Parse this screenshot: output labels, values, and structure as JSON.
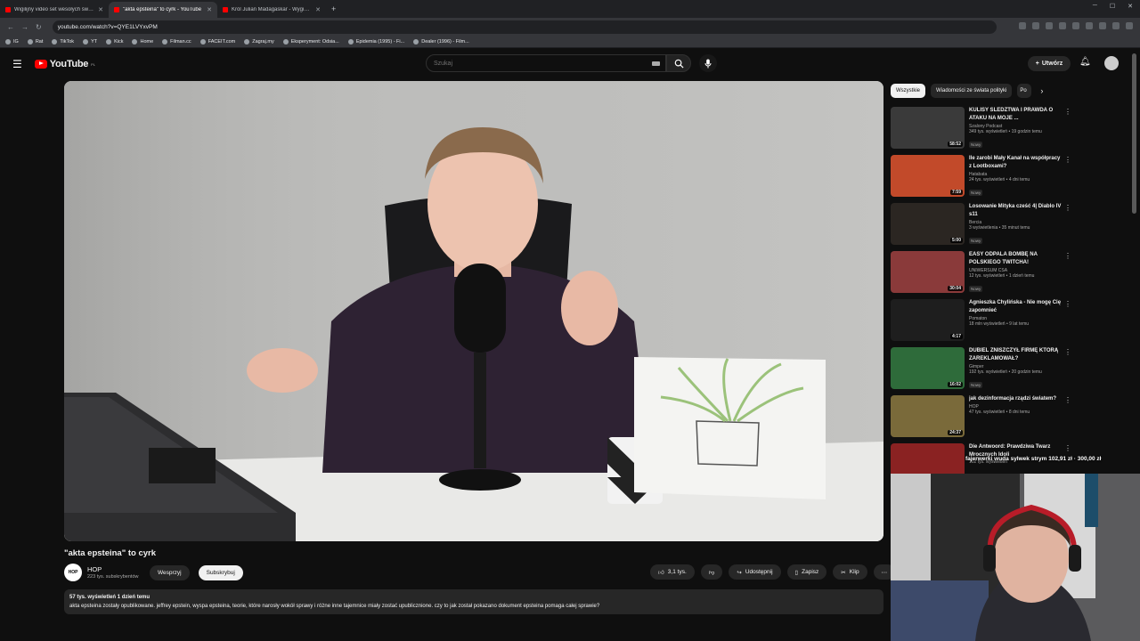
{
  "browser": {
    "tabs": [
      {
        "label": "Wigilijny video set wesołych świąt i..."
      },
      {
        "label": "\"akta epsteina\" to cyrk - YouTube"
      },
      {
        "label": "Król Julian Madagaskar - Wyginam S..."
      }
    ],
    "url": "youtube.com/watch?v=QYE1LVYxvPM",
    "bookmarks": [
      "IG",
      "Rat",
      "TikTok",
      "YT",
      "Kick",
      "Home",
      "Filman.cc",
      "FACEIT.com",
      "Zagraj.my",
      "Eksperyment: Odsia...",
      "Epidemia (1995) - Fi...",
      "Dealer (1996) - Film..."
    ]
  },
  "youtube": {
    "logo": "YouTube",
    "country": "PL",
    "search_placeholder": "Szukaj",
    "create_label": "Utwórz"
  },
  "video": {
    "title": "\"akta epsteina\" to cyrk",
    "channel": "HOP",
    "channel_avatar": "HOP",
    "subscribers": "223 tys. subskrybentów",
    "support_label": "Wesprzyj",
    "subscribe_label": "Subskrybuj",
    "likes": "3,1 tys.",
    "share_label": "Udostępnij",
    "save_label": "Zapisz",
    "clip_label": "Klip",
    "stats": "57 tys. wyświetleń  1 dzień temu",
    "description": "akta epsteina zostały opublikowane. jeffrey epstein, wyspa epsteina, teorie, które narosły wokół sprawy i różne inne tajemnice miały zostać upublicznione. czy to jak został pokazano dokument epsteina pomaga całej sprawie?"
  },
  "chips": [
    "Wszystkie",
    "Wiadomości ze świata polityki",
    "Po"
  ],
  "recommendations": [
    {
      "title": "KULISY ŚLEDZTWA I PRAWDA O ATAKU NA MOJE ...",
      "channel": "Szalony Podcast",
      "views": "349 tys. wyświetleń • 19 godzin temu",
      "badge": "Nowy",
      "duration": "58:52",
      "color": "#3a3a3a"
    },
    {
      "title": "Ile zarobi Mały Kanał na współpracy z Lootboxami?",
      "channel": "Hatabata",
      "views": "24 tys. wyświetleń • 4 dni temu",
      "badge": "Nowy",
      "duration": "7:59",
      "color": "#c24a2a"
    },
    {
      "title": "Losowanie Mityka cześć 4| Diablo IV s11",
      "channel": "Bercia",
      "views": "3 wyświetlenia • 35 minut temu",
      "badge": "Nowy",
      "duration": "5:00",
      "color": "#2b2622"
    },
    {
      "title": "EASY ODPALA BOMBĘ NA POLSKIEGO TWITCHA!",
      "channel": "UNIWERSUM CSA",
      "views": "12 tys. wyświetleń • 1 dzień temu",
      "badge": "Nowy",
      "duration": "30:04",
      "color": "#8a3a3a"
    },
    {
      "title": "Agnieszka Chylińska - Nie mogę Cię zapomnieć",
      "channel": "Pomaton",
      "views": "18 mln wyświetleń • 9 lat temu",
      "badge": "",
      "duration": "4:17",
      "color": "#1e1e1e"
    },
    {
      "title": "DUBIEL ZNISZCZYŁ FIRMĘ KTÓRĄ ZAREKLAMOWAŁ?",
      "channel": "Gimper",
      "views": "192 tys. wyświetleń • 20 godzin temu",
      "badge": "Nowy",
      "duration": "16:02",
      "color": "#2e6b3a"
    },
    {
      "title": "jak dezinformacja rządzi światem?",
      "channel": "HOP",
      "views": "47 tys. wyświetleń • 8 dni temu",
      "badge": "",
      "duration": "24:37",
      "color": "#7a6a3a"
    },
    {
      "title": "Die Antwoord: Prawdziwa Twarz Mrocznych Idoli",
      "channel": "",
      "views": "102 tys. wyświetleń",
      "badge": "",
      "duration": "",
      "color": "#8a2222"
    }
  ],
  "overlay_text": "fajerwerki wuda sylwek strym 102,91 zł · 300,00 zł",
  "colors": {
    "youtube_red": "#ff0000",
    "background": "#0f0f0f"
  }
}
